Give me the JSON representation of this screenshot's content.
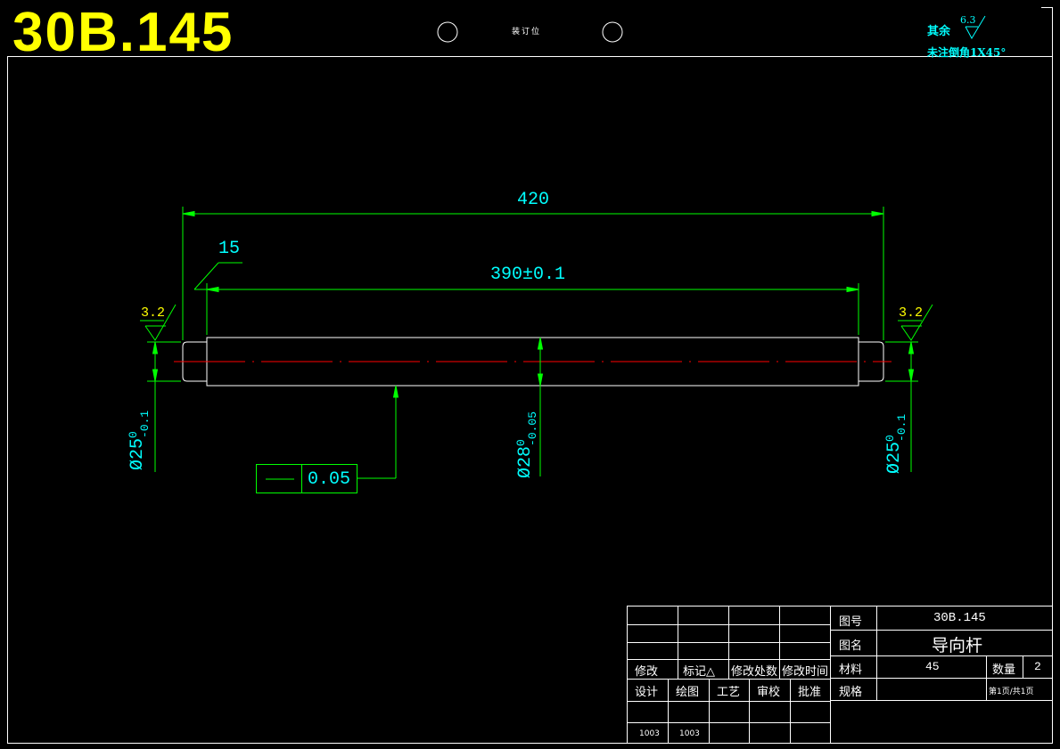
{
  "header": {
    "drawing_code": "30B.145",
    "binding_label": "装订位",
    "roughness_label": "其余",
    "roughness_value": "6.3",
    "chamfer_note": "未注倒角1X45°"
  },
  "dimensions": {
    "overall_length": "420",
    "shoulder_length": "15",
    "main_length": "390±0.1",
    "left_roughness": "3.2",
    "right_roughness": "3.2",
    "left_diameter": "Ø25",
    "left_diameter_tol_upper": "0",
    "left_diameter_tol_lower": "-0.1",
    "main_diameter": "Ø28",
    "main_diameter_tol_upper": "0",
    "main_diameter_tol_lower": "-0.05",
    "right_diameter": "Ø25",
    "right_diameter_tol_upper": "0",
    "right_diameter_tol_lower": "-0.1",
    "straightness_tolerance": "0.05"
  },
  "title_block": {
    "drawing_no_label": "图号",
    "drawing_no": "30B.145",
    "name_label": "图名",
    "part_name": "导向杆",
    "material_label": "材料",
    "material": "45",
    "quantity_label": "数量",
    "quantity": "2",
    "spec_label": "规格",
    "page_info": "第1页/共1页",
    "revision_headers": [
      "修改",
      "标记△",
      "修改处数",
      "修改时间"
    ],
    "signoff_headers": [
      "设计",
      "绘图",
      "工艺",
      "审校",
      "批准"
    ],
    "signoff_values": [
      "1003",
      "1003"
    ]
  },
  "colors": {
    "background": "#000000",
    "outline": "#ffffff",
    "dimension_line": "#00ff00",
    "dimension_text": "#00ffff",
    "centerline": "#ff0000",
    "title_text": "#ffff00"
  }
}
